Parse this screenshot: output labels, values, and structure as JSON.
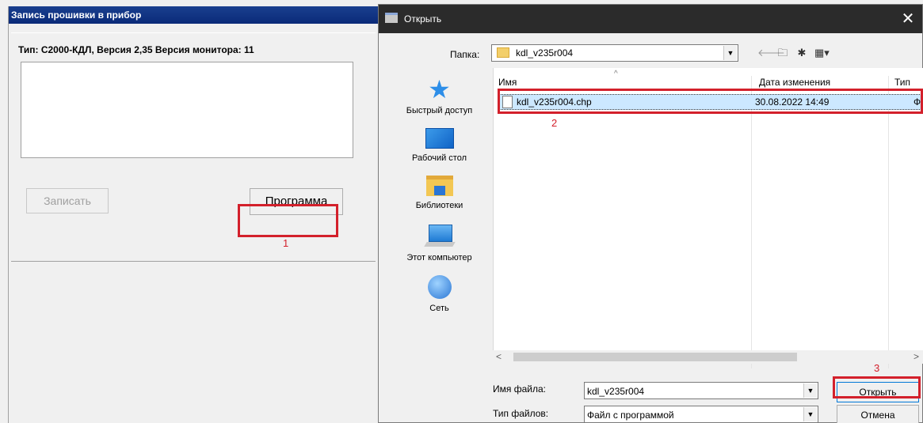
{
  "left_window": {
    "title": "Запись прошивки в прибор",
    "device_info": "Тип: С2000-КДЛ, Версия 2,35 Версия монитора: 11",
    "write_button": "Записать",
    "program_button": "Программа",
    "marker": "1"
  },
  "dialog": {
    "title": "Открыть",
    "close_glyph": "✕",
    "folder_label": "Папка:",
    "folder_value": "kdl_v235r004",
    "nav_icons": [
      "back-icon",
      "up-folder-icon",
      "new-folder-icon",
      "view-menu-icon"
    ],
    "places": [
      {
        "label": "Быстрый доступ",
        "icon": "star-icon"
      },
      {
        "label": "Рабочий стол",
        "icon": "desktop-icon"
      },
      {
        "label": "Библиотеки",
        "icon": "libraries-icon"
      },
      {
        "label": "Этот компьютер",
        "icon": "computer-icon"
      },
      {
        "label": "Сеть",
        "icon": "network-icon"
      }
    ],
    "columns": {
      "name": "Имя",
      "date": "Дата изменения",
      "type": "Тип"
    },
    "files": [
      {
        "name": "kdl_v235r004.chp",
        "date": "30.08.2022 14:49",
        "type": "Файл"
      }
    ],
    "filename_label": "Имя файла:",
    "filename_value": "kdl_v235r004",
    "filetype_label": "Тип файлов:",
    "filetype_value": "Файл с программой",
    "open_button": "Открыть",
    "cancel_button": "Отмена",
    "marker_file": "2",
    "marker_open": "3"
  }
}
